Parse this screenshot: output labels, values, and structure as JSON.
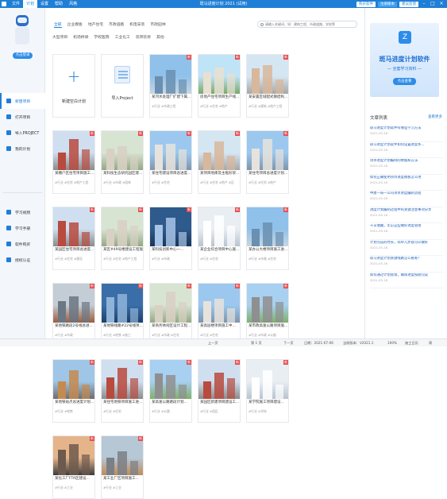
{
  "app": {
    "title": "斑马进度计划 2021 (试用)",
    "menu": [
      "文件",
      "计划",
      "设置",
      "帮助",
      "风格"
    ],
    "active_menu": "计划",
    "btn_purchase": "购买软件",
    "btn_register": "注册版本",
    "btn_login_shortcut": "建议反馈"
  },
  "sidebar": {
    "login_label": "点击登录",
    "items_top": [
      {
        "label": "新建项目",
        "icon": "new-file-icon"
      },
      {
        "label": "打开项目",
        "icon": "folder-icon"
      },
      {
        "label": "导入PROJECT",
        "icon": "import-icon"
      },
      {
        "label": "我的计划",
        "icon": "plan-icon"
      }
    ],
    "items_bottom": [
      {
        "label": "学习视频",
        "icon": "video-icon"
      },
      {
        "label": "学习手册",
        "icon": "book-icon"
      },
      {
        "label": "软件购买",
        "icon": "cart-icon"
      },
      {
        "label": "授权认证",
        "icon": "key-icon"
      }
    ]
  },
  "main": {
    "categories": [
      "全部",
      "企业模板",
      "地产住宅",
      "市政道路",
      "机电安装",
      "市政园林"
    ],
    "active_category": "全部",
    "subcategories": [
      "大型项目",
      "机场桥梁",
      "学校医院",
      "工业化工",
      "装饰装修",
      "其他"
    ],
    "search_placeholder": "请输入关键词，如：建筑工程、市政道路、学校等",
    "blank_card": "新建空白计划",
    "import_card": "导入Project",
    "new_badge": "新",
    "cards": [
      {
        "title": "某河水处理厂扩建下属...",
        "tags": "#行业 #市政工程",
        "new": true,
        "theme": "blue"
      },
      {
        "title": "房地产住宅项目生产线...",
        "tags": "#行业 #住宅 #地产",
        "new": true,
        "theme": "green"
      },
      {
        "title": "某安置区域配式钢结构...",
        "tags": "#行业 #建筑 #地产工程",
        "new": true,
        "theme": "tower"
      },
      {
        "title": "某棚户区住宅项目施工...",
        "tags": "#行业 #住宅 #地产工程",
        "new": true,
        "theme": "red"
      },
      {
        "title": "某科技生态研究园区建...",
        "tags": "#行业 #市政 #园林",
        "new": true,
        "theme": "aerial"
      },
      {
        "title": "某住宅建设项目总进度...",
        "tags": "#行业 #住宅",
        "new": true,
        "theme": "highrise"
      },
      {
        "title": "某项目地库及主框形架...",
        "tags": "#行业 #住宅 #地产 #区",
        "new": true,
        "theme": "tower"
      },
      {
        "title": "某住宅项目总进度计划...",
        "tags": "#行业 #住宅 #地产",
        "new": true,
        "theme": "highrise"
      },
      {
        "title": "某园区住宅项目总进度...",
        "tags": "#行业 #住宅 #建设",
        "new": true,
        "theme": "red"
      },
      {
        "title": "某区#49号楼建设工程施...",
        "tags": "#行业 #住宅 #地产工程",
        "new": true,
        "theme": "aerial"
      },
      {
        "title": "某科技创新中心一...",
        "tags": "#行业 #市政",
        "new": true,
        "theme": "night"
      },
      {
        "title": "某企业综合项目中心施...",
        "tags": "#行业 #住宅",
        "new": true,
        "theme": "white"
      },
      {
        "title": "某办公大楼项目施工进...",
        "tags": "#行业 #市政 #住宅",
        "new": true,
        "theme": "blue"
      },
      {
        "title": "某地铁路段2号线总进...",
        "tags": "#行业 #市政",
        "new": true,
        "theme": "steel"
      },
      {
        "title": "某地铁线路#22号线项...",
        "tags": "#行业 #地铁 #施工",
        "new": true,
        "theme": "tunnel"
      },
      {
        "title": "某商务休闲区设计工程...",
        "tags": "#行业 #市政 #住宅",
        "new": true,
        "theme": "aerial"
      },
      {
        "title": "某高层楼项目施工中...",
        "tags": "#行业 #住宅",
        "new": true,
        "theme": "highrise"
      },
      {
        "title": "某市政高速公路项目施...",
        "tags": "#行业 #市政 #公路",
        "new": true,
        "theme": "highway"
      },
      {
        "title": "某地铁站点总进度计划...",
        "tags": "#行业 #地铁",
        "new": true,
        "theme": "crane"
      },
      {
        "title": "某住宅地铁项目施工进...",
        "tags": "#行业 #住宅",
        "new": true,
        "theme": "red"
      },
      {
        "title": "某高速公路路段计划...",
        "tags": "#行业 #公路",
        "new": true,
        "theme": "highway"
      },
      {
        "title": "某园区新建项目建设工...",
        "tags": "#行业 #园区",
        "new": true,
        "theme": "red"
      },
      {
        "title": "某学院施工项目建设...",
        "tags": "#行业 #学校",
        "new": true,
        "theme": "white"
      },
      {
        "title": "某化工厂FTA区建设...",
        "tags": "#行业 #工业",
        "new": true,
        "theme": "sunset"
      },
      {
        "title": "某工业厂区项目施工...",
        "tags": "#行业 #工业",
        "new": true,
        "theme": "industrial"
      }
    ]
  },
  "right_panel": {
    "ad": {
      "logo": "Z",
      "title": "斑马进度计划软件",
      "subtitle": "— 全套学习资料 —",
      "button": "点击查看"
    },
    "articles_title": "文章列表",
    "more": "查看更多",
    "articles": [
      {
        "title": "斑马进度计划软件有哪些学习方法",
        "date": "2021-05-18"
      },
      {
        "title": "斑马进度计划软件如何设置进度条...",
        "date": "2021-05-18"
      },
      {
        "title": "项目进度计划编制的依据和方法",
        "date": "2021-05-18"
      },
      {
        "title": "如何正确使用项目进度模板怎么用",
        "date": "2021-05-18"
      },
      {
        "title": "中建一局一公司项目进度编制流程",
        "date": "2021-05-18"
      },
      {
        "title": "进度计划编制过程中的关键注意事项分享",
        "date": "2021-05-18"
      },
      {
        "title": "干货收藏，牢记这些做好进度管理",
        "date": "2021-05-18"
      },
      {
        "title": "计划完成的时长，简单几步就可以做好",
        "date": "2021-05-18"
      },
      {
        "title": "斑马进度计划关键线路怎么看呢？",
        "date": "2021-05-18"
      },
      {
        "title": "如何通过计划管理，确保进度按期完成",
        "date": "2021-05-18"
      }
    ]
  },
  "status": {
    "prev": "上一页",
    "page": "第 1 页",
    "next": "下一页",
    "date_label": "日期：2021-07-06",
    "version": "当前版本：V2021.1",
    "zoom": "100%",
    "mode": "施工日历",
    "weeks": "周"
  }
}
